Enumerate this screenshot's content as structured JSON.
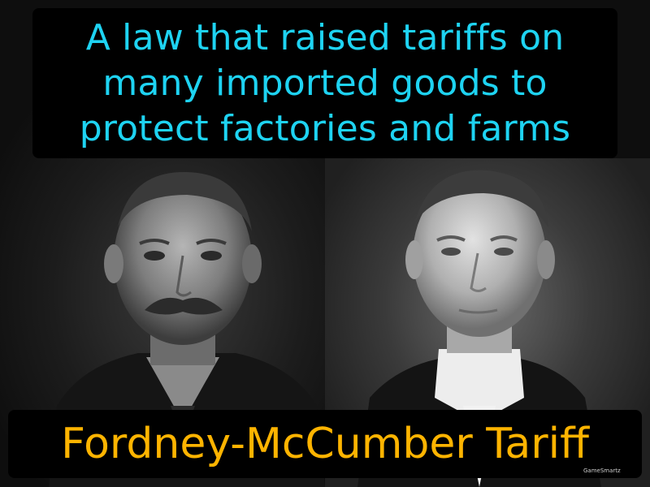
{
  "definition": {
    "text": "A law that raised tariffs on\nmany imported goods to\nprotect factories and farms"
  },
  "term": {
    "text": "Fordney-McCumber Tariff"
  },
  "brand": {
    "text": "GameSmartz"
  },
  "colors": {
    "definition_text": "#1ed3f2",
    "term_text": "#ffb400",
    "box_background": "#000000"
  },
  "images": [
    {
      "description": "portrait-man-with-mustache"
    },
    {
      "description": "portrait-man-in-high-collar"
    }
  ]
}
